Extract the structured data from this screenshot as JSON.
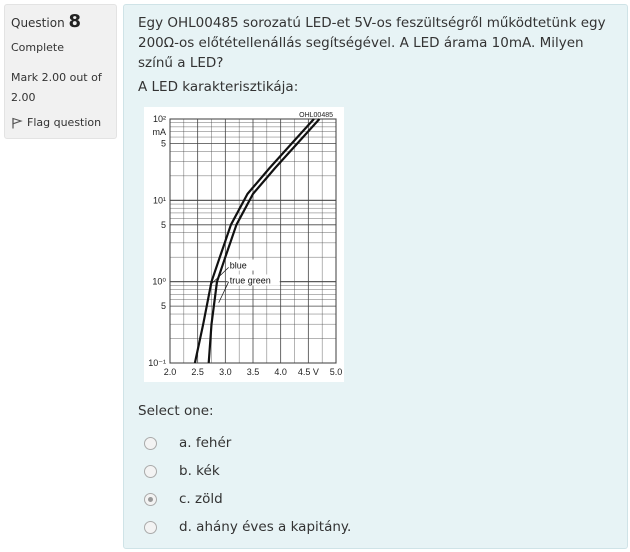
{
  "question": {
    "label": "Question",
    "number": "8",
    "state": "Complete",
    "grade_line1": "Mark 2.00 out of",
    "grade_line2": "2.00",
    "flag_label": "Flag question"
  },
  "content": {
    "text": "Egy OHL00485 sorozatú LED-et 5V-os feszültségről működtetünk egy 200Ω-os előtétellenállás segítségével. A LED árama 10mA. Milyen színű a LED?",
    "caption": "A LED karakterisztikája:",
    "select_prompt": "Select one:",
    "options": [
      {
        "letter": "a.",
        "text": "fehér",
        "checked": false
      },
      {
        "letter": "b.",
        "text": "kék",
        "checked": false
      },
      {
        "letter": "c.",
        "text": "zöld",
        "checked": true
      },
      {
        "letter": "d.",
        "text": "ahány éves a kapitány.",
        "checked": false
      }
    ]
  },
  "chart_data": {
    "type": "line",
    "title": "OHL00485",
    "ylabel": "mA",
    "xlabel": "V",
    "x_ticks": [
      "2.0",
      "2.5",
      "3.0",
      "3.5",
      "4.0",
      "4.5 V",
      "5.0"
    ],
    "y_ticks": [
      "10²",
      "5",
      "10¹",
      "5",
      "10⁰",
      "5",
      "10⁻¹"
    ],
    "xlim": [
      2.0,
      5.0
    ],
    "ylim": [
      0.1,
      100
    ],
    "yscale": "log",
    "grid": true,
    "annotations": [
      "blue",
      "true green"
    ],
    "series": [
      {
        "name": "blue",
        "x": [
          2.45,
          2.6,
          2.75,
          2.9,
          3.1,
          3.4,
          3.8,
          4.2,
          4.6
        ],
        "y": [
          0.1,
          0.3,
          1,
          2,
          5,
          12,
          25,
          50,
          100
        ]
      },
      {
        "name": "true green",
        "x": [
          2.7,
          2.75,
          2.85,
          3.0,
          3.2,
          3.5,
          3.9,
          4.3,
          4.7
        ],
        "y": [
          0.1,
          0.3,
          1,
          2,
          5,
          12,
          25,
          50,
          100
        ]
      }
    ]
  }
}
